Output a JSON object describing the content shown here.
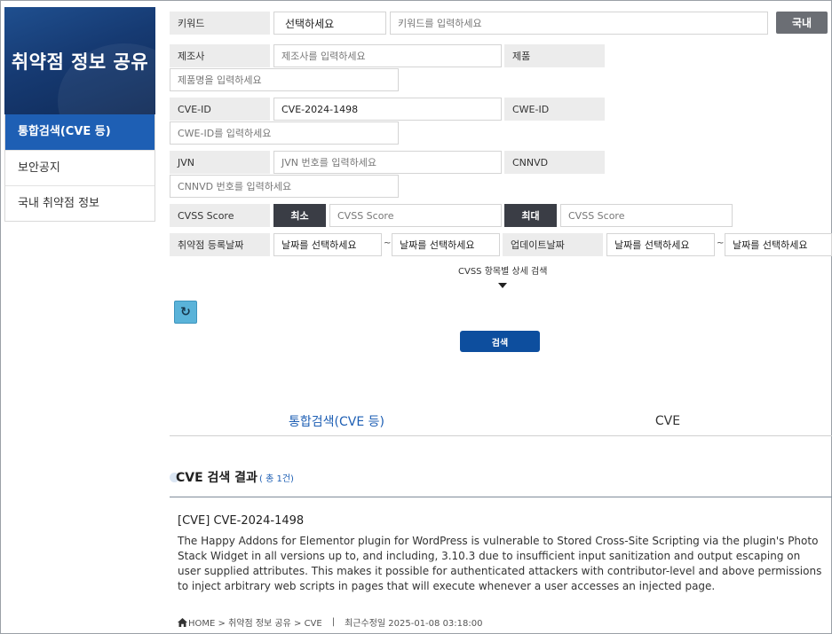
{
  "sidebar": {
    "banner_title": "취약점 정보 공유",
    "items": [
      {
        "label": "통합검색(CVE 등)"
      },
      {
        "label": "보안공지"
      },
      {
        "label": "국내 취약점 정보"
      }
    ]
  },
  "form": {
    "keyword_label": "키워드",
    "keyword_select": "선택하세요",
    "keyword_placeholder": "키워드를 입력하세요",
    "domestic_button": "국내",
    "vendor_label": "제조사",
    "vendor_placeholder": "제조사를 입력하세요",
    "product_label": "제품",
    "product_placeholder": "제품명을 입력하세요",
    "cve_id_label": "CVE-ID",
    "cve_id_value": "CVE-2024-1498",
    "cwe_id_label": "CWE-ID",
    "cwe_id_placeholder": "CWE-ID를 입력하세요",
    "jvn_label": "JVN",
    "jvn_placeholder": "JVN 번호를 입력하세요",
    "cnnvd_label": "CNNVD",
    "cnnvd_placeholder": "CNNVD 번호를 입력하세요",
    "cvss_label": "CVSS Score",
    "cvss_min_button": "최소",
    "cvss_min_placeholder": "CVSS Score",
    "cvss_max_button": "최대",
    "cvss_max_placeholder": "CVSS Score",
    "reg_date_label": "취약점 등록날짜",
    "reg_date_from": "날짜를 선택하세요",
    "tilde": "~",
    "reg_date_to": "날짜를 선택하세요",
    "upd_date_label": "업데이트날짜",
    "upd_date_from": "날짜를 선택하세요",
    "upd_date_to": "날짜를 선택하세요",
    "cvss_detail_toggle": "CVSS 항목별 상세 검색",
    "reset_icon": "↻",
    "search_button": "검색"
  },
  "tabs": [
    {
      "label": "통합검색(CVE 등)"
    },
    {
      "label": "CVE"
    }
  ],
  "results": {
    "title": "CVE 검색 결과",
    "count": "( 총 1건)",
    "item": {
      "title": "[CVE] CVE-2024-1498",
      "description": "The Happy Addons for Elementor plugin for WordPress is vulnerable to Stored Cross-Site Scripting via the plugin's Photo Stack Widget in all versions up to, and including, 3.10.3 due to insufficient input sanitization and output escaping on user supplied attributes. This makes it possible for authenticated attackers with contributor-level and above permissions to inject arbitrary web scripts in pages that will execute whenever a user accesses an injected page.",
      "breadcrumb": "HOME > 취약점 정보 공유 > CVE",
      "separator": "|",
      "updated": "최근수정일 2025-01-08 03:18:00"
    }
  },
  "colors": {
    "primary": "#1e5fb4",
    "banner": "#163a72",
    "search_button": "#0d4e9e",
    "reset_button": "#5ab3d9"
  }
}
